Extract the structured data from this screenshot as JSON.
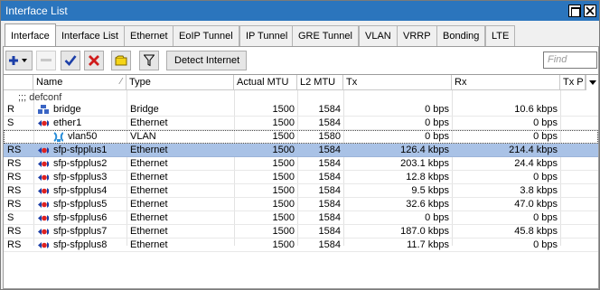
{
  "window": {
    "title": "Interface List"
  },
  "tabs": [
    "Interface",
    "Interface List",
    "Ethernet",
    "EoIP Tunnel",
    "IP Tunnel",
    "GRE Tunnel",
    "VLAN",
    "VRRP",
    "Bonding",
    "LTE"
  ],
  "toolbar": {
    "detect_label": "Detect Internet",
    "find_placeholder": "Find",
    "icons": [
      "add-icon",
      "remove-icon",
      "enable-icon",
      "disable-icon",
      "comment-icon",
      "filter-icon"
    ]
  },
  "columns": [
    "",
    "Name",
    "Type",
    "Actual MTU",
    "L2 MTU",
    "Tx",
    "Rx",
    "Tx P"
  ],
  "group_comment": ";;; defconf",
  "rows": [
    {
      "flags": "R",
      "name": "bridge",
      "type": "Bridge",
      "mtu": "1500",
      "l2mtu": "1584",
      "tx": "0 bps",
      "rx": "10.6 kbps",
      "icon": "bridge-icon"
    },
    {
      "flags": "S",
      "name": "ether1",
      "type": "Ethernet",
      "mtu": "1500",
      "l2mtu": "1584",
      "tx": "0 bps",
      "rx": "0 bps",
      "icon": "ethernet-icon"
    },
    {
      "flags": "",
      "name": "vlan50",
      "type": "VLAN",
      "mtu": "1500",
      "l2mtu": "1580",
      "tx": "0 bps",
      "rx": "0 bps",
      "icon": "vlan-icon"
    },
    {
      "flags": "RS",
      "name": "sfp-sfpplus1",
      "type": "Ethernet",
      "mtu": "1500",
      "l2mtu": "1584",
      "tx": "126.4 kbps",
      "rx": "214.4 kbps",
      "icon": "ethernet-icon"
    },
    {
      "flags": "RS",
      "name": "sfp-sfpplus2",
      "type": "Ethernet",
      "mtu": "1500",
      "l2mtu": "1584",
      "tx": "203.1 kbps",
      "rx": "24.4 kbps",
      "icon": "ethernet-icon"
    },
    {
      "flags": "RS",
      "name": "sfp-sfpplus3",
      "type": "Ethernet",
      "mtu": "1500",
      "l2mtu": "1584",
      "tx": "12.8 kbps",
      "rx": "0 bps",
      "icon": "ethernet-icon"
    },
    {
      "flags": "RS",
      "name": "sfp-sfpplus4",
      "type": "Ethernet",
      "mtu": "1500",
      "l2mtu": "1584",
      "tx": "9.5 kbps",
      "rx": "3.8 kbps",
      "icon": "ethernet-icon"
    },
    {
      "flags": "RS",
      "name": "sfp-sfpplus5",
      "type": "Ethernet",
      "mtu": "1500",
      "l2mtu": "1584",
      "tx": "32.6 kbps",
      "rx": "47.0 kbps",
      "icon": "ethernet-icon"
    },
    {
      "flags": "S",
      "name": "sfp-sfpplus6",
      "type": "Ethernet",
      "mtu": "1500",
      "l2mtu": "1584",
      "tx": "0 bps",
      "rx": "0 bps",
      "icon": "ethernet-icon"
    },
    {
      "flags": "RS",
      "name": "sfp-sfpplus7",
      "type": "Ethernet",
      "mtu": "1500",
      "l2mtu": "1584",
      "tx": "187.0 kbps",
      "rx": "45.8 kbps",
      "icon": "ethernet-icon"
    },
    {
      "flags": "RS",
      "name": "sfp-sfpplus8",
      "type": "Ethernet",
      "mtu": "1500",
      "l2mtu": "1584",
      "tx": "11.7 kbps",
      "rx": "0 bps",
      "icon": "ethernet-icon"
    }
  ],
  "selected_row": 3,
  "colors": {
    "titlebar": "#2b75bd",
    "selection": "#a9c2e6"
  }
}
